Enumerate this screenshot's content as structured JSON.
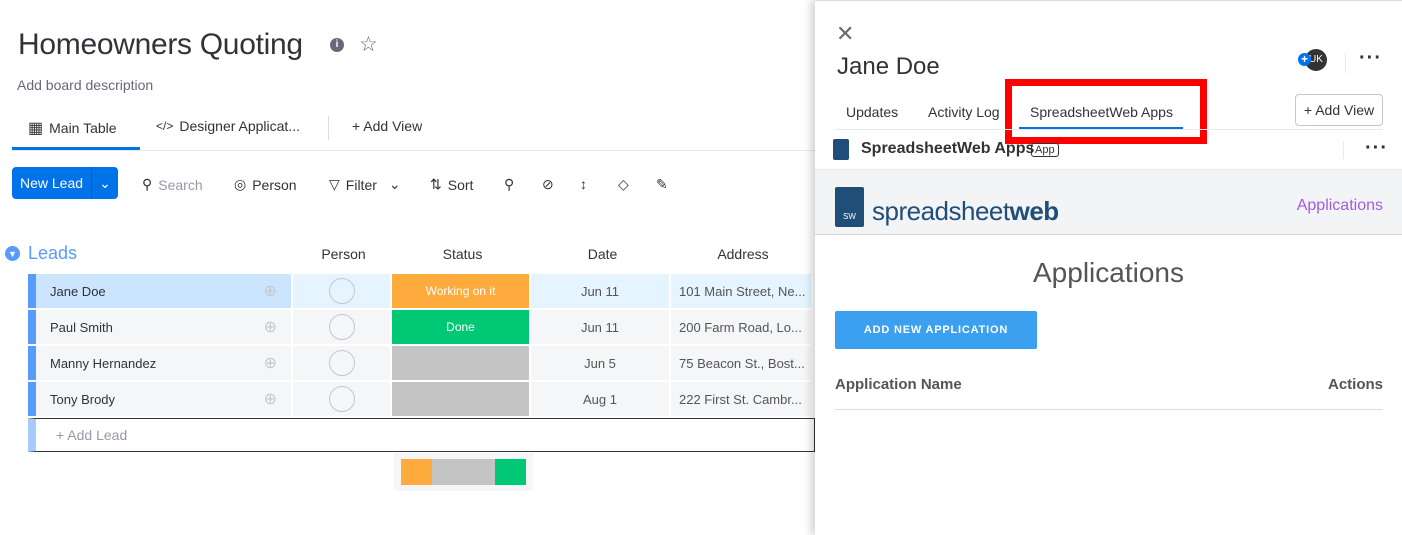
{
  "board": {
    "title": "Homeowners Quoting",
    "description": "Add board description"
  },
  "views": {
    "tabs": [
      {
        "label": "Main Table",
        "active": true
      },
      {
        "label": "Designer Applicat..."
      }
    ],
    "add_view": "+ Add View"
  },
  "toolbar": {
    "new_label": "New Lead",
    "search_placeholder": "Search",
    "person": "Person",
    "filter": "Filter",
    "sort": "Sort"
  },
  "group": {
    "name": "Leads",
    "color": "#579bfc"
  },
  "columns": [
    "Person",
    "Status",
    "Date",
    "Address"
  ],
  "rows": [
    {
      "name": "Jane Doe",
      "status": "Working on it",
      "status_color": "#fdab3d",
      "date": "Jun 11",
      "address": "101 Main Street, Ne..."
    },
    {
      "name": "Paul Smith",
      "status": "Done",
      "status_color": "#00c875",
      "date": "Jun 11",
      "address": "200 Farm Road, Lo..."
    },
    {
      "name": "Manny Hernandez",
      "status": "",
      "status_color": "#c4c4c4",
      "date": "Jun 5",
      "address": "75 Beacon St., Bost..."
    },
    {
      "name": "Tony Brody",
      "status": "",
      "status_color": "#c4c4c4",
      "date": "Aug 1",
      "address": "222 First St. Cambr..."
    }
  ],
  "add_item": "+ Add Lead",
  "status_summary": [
    {
      "color": "#fdab3d",
      "fraction": 0.25
    },
    {
      "color": "#c4c4c4",
      "fraction": 0.5
    },
    {
      "color": "#00c875",
      "fraction": 0.25
    }
  ],
  "panel": {
    "title": "Jane Doe",
    "avatar": "UK",
    "tabs": [
      "Updates",
      "Activity Log",
      "SpreadsheetWeb Apps"
    ],
    "active_tab": "SpreadsheetWeb Apps",
    "add_view": "+ Add View",
    "app_name": "SpreadsheetWeb Apps",
    "app_badge": "App",
    "logo_text_1": "spreadsheet",
    "logo_text_2": "web",
    "nav_link": "Applications",
    "heading": "Applications",
    "add_button": "ADD NEW APPLICATION",
    "table_headers": [
      "Application Name",
      "Actions"
    ],
    "highlight_color": "#ff0000"
  }
}
